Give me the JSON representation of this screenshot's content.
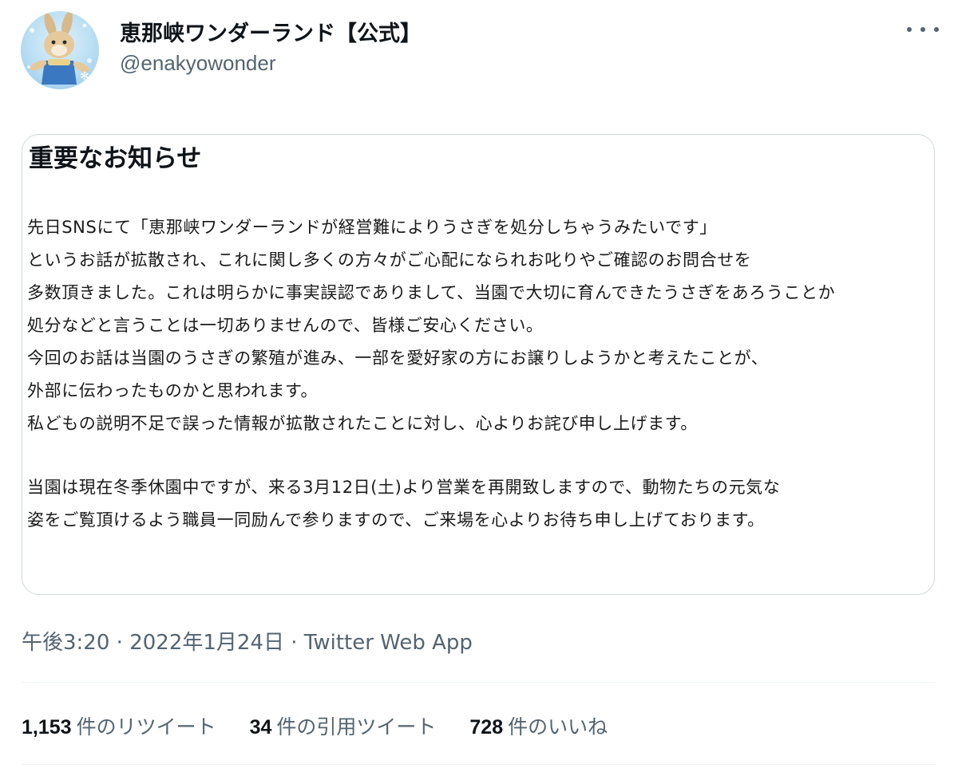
{
  "tweet": {
    "author": {
      "display_name": "恵那峡ワンダーランド【公式】",
      "handle": "@enakyowonder",
      "avatar_icon": "rabbit-mascot-avatar"
    },
    "more_icon": "more-dots-icon",
    "notice": {
      "title": "重要なお知らせ",
      "lines": [
        "先日SNSにて「恵那峡ワンダーランドが経営難によりうさぎを処分しちゃうみたいです」",
        "というお話が拡散され、これに関し多くの方々がご心配になられお叱りやご確認のお問合せを",
        "多数頂きました。これは明らかに事実誤認でありまして、当園で大切に育んできたうさぎをあろうことか",
        "処分などと言うことは一切ありませんので、皆様ご安心ください。",
        "今回のお話は当園のうさぎの繁殖が進み、一部を愛好家の方にお譲りしようかと考えたことが、",
        "外部に伝わったものかと思われます。",
        "私どもの説明不足で誤った情報が拡散されたことに対し、心よりお詫び申し上げます。",
        "当園は現在冬季休園中ですが、来る3月12日(土)より営業を再開致しますので、動物たちの元気な",
        "姿をご覧頂けるよう職員一同励んで参りますので、ご来場を心よりお待ち申し上げております。"
      ]
    },
    "meta": {
      "time": "午後3:20",
      "separator": "·",
      "date": "2022年1月24日",
      "source": "Twitter Web App"
    },
    "stats": [
      {
        "count": "1,153",
        "label": "件のリツイート"
      },
      {
        "count": "34",
        "label": "件の引用ツイート"
      },
      {
        "count": "728",
        "label": "件のいいね"
      }
    ]
  }
}
